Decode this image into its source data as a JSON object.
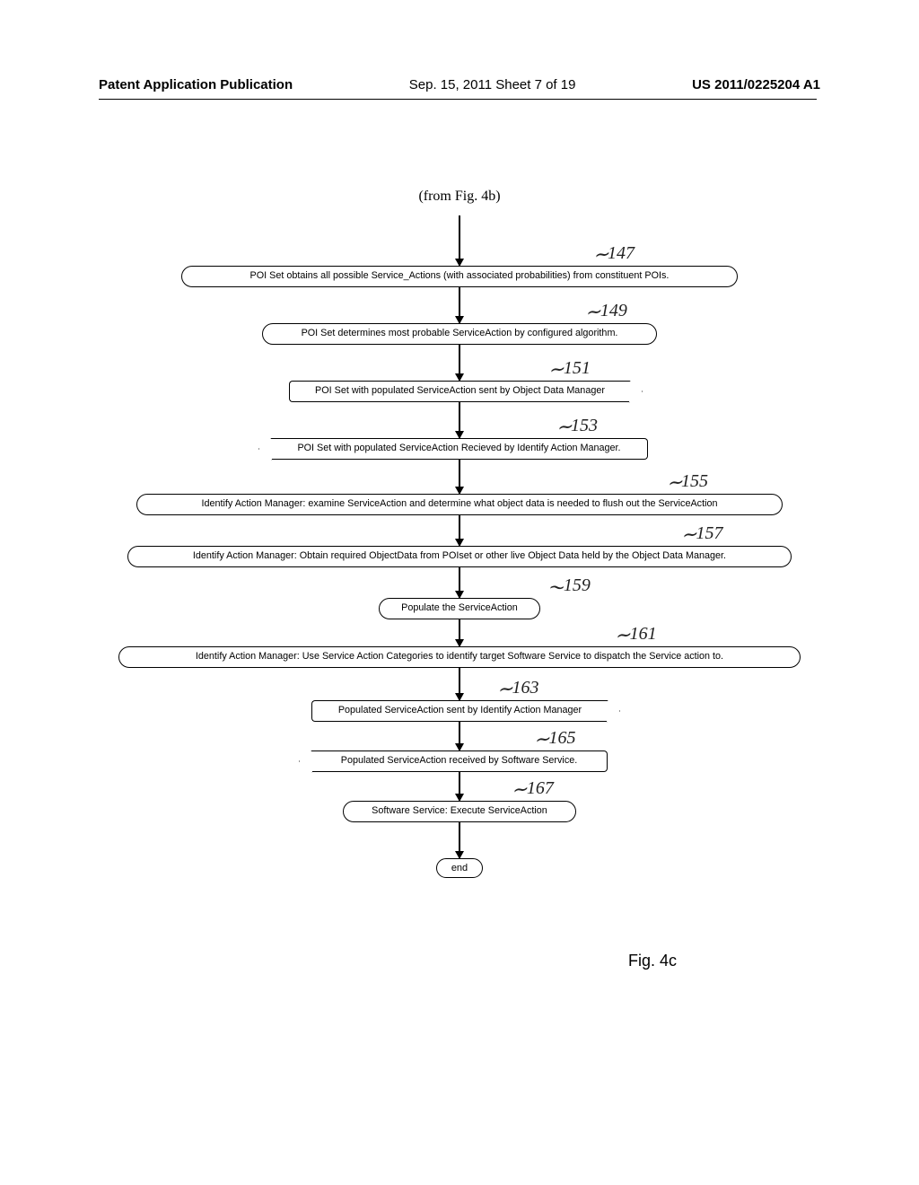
{
  "header": {
    "left": "Patent Application Publication",
    "mid": "Sep. 15, 2011  Sheet 7 of 19",
    "right": "US 2011/0225204 A1"
  },
  "from_label": "(from Fig. 4b)",
  "fig_label": "Fig. 4c",
  "end_label": "end",
  "steps": {
    "s147": {
      "num": "147",
      "text": "POI Set obtains all possible Service_Actions (with associated probabilities) from constituent POIs."
    },
    "s149": {
      "num": "149",
      "text": "POI Set determines most probable ServiceAction by configured algorithm."
    },
    "s151": {
      "num": "151",
      "text": "POI Set with populated ServiceAction sent by Object Data Manager"
    },
    "s153": {
      "num": "153",
      "text": "POI Set with populated ServiceAction Recieved by Identify Action Manager."
    },
    "s155": {
      "num": "155",
      "text": "Identify Action Manager: examine ServiceAction and determine what object data is needed to flush out the ServiceAction"
    },
    "s157": {
      "num": "157",
      "text": "Identify Action Manager: Obtain required ObjectData from POIset or other live Object Data held by the Object Data Manager."
    },
    "s159": {
      "num": "159",
      "text": "Populate the ServiceAction"
    },
    "s161": {
      "num": "161",
      "text": "Identify Action Manager: Use Service Action Categories to identify target Software Service to dispatch the Service action to."
    },
    "s163": {
      "num": "163",
      "text": "Populated ServiceAction sent by Identify Action Manager"
    },
    "s165": {
      "num": "165",
      "text": "Populated ServiceAction received by Software Service."
    },
    "s167": {
      "num": "167",
      "text": "Software Service:  Execute ServiceAction"
    }
  }
}
